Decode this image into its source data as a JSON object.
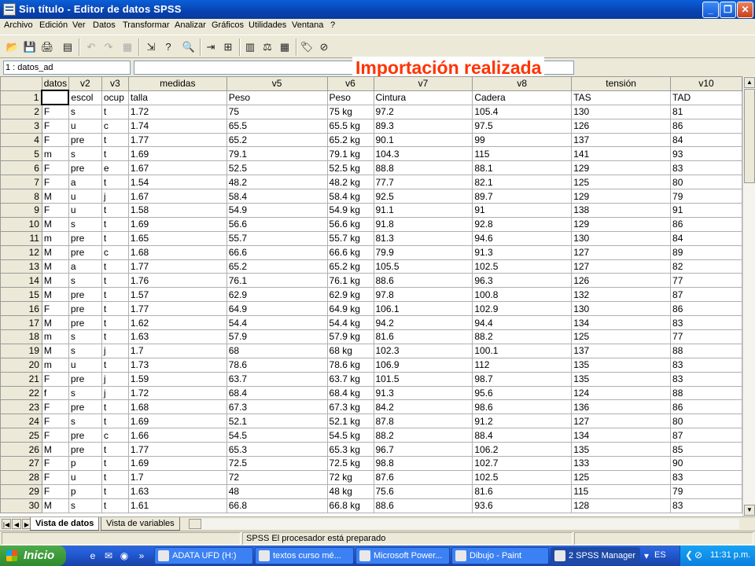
{
  "window": {
    "title": "Sin título - Editor de datos SPSS",
    "minimize_label": "_",
    "maximize_label": "❐",
    "close_label": "✕"
  },
  "menu": [
    "Archivo",
    "Edición",
    "Ver",
    "Datos",
    "Transformar",
    "Analizar",
    "Gráficos",
    "Utilidades",
    "Ventana",
    "?"
  ],
  "toolbar": {
    "icons": [
      "open-icon",
      "save-icon",
      "print-icon",
      "dialog-recall-icon",
      "undo-icon",
      "redo-icon",
      "chart-builder-icon",
      "goto-case-icon",
      "variables-info-icon",
      "find-icon",
      "insert-case-icon",
      "insert-variable-icon",
      "split-file-icon",
      "weight-cases-icon",
      "select-cases-icon",
      "value-labels-icon",
      "use-sets-icon"
    ]
  },
  "cell_editor": {
    "reference": "1 : datos_ad",
    "value": ""
  },
  "overlay_caption": "Importación realizada",
  "columns": [
    "datos",
    "v2",
    "v3",
    "medidas",
    "v5",
    "v6",
    "v7",
    "v8",
    "tensión",
    "v10"
  ],
  "rows": [
    [
      "",
      "escol",
      "ocup",
      "talla",
      "Peso",
      "Peso",
      "Cintura",
      "Cadera",
      "TAS",
      "TAD"
    ],
    [
      "F",
      "s",
      "t",
      "1.72",
      "75",
      "75 kg",
      "97.2",
      "105.4",
      "130",
      "81"
    ],
    [
      "F",
      "u",
      "c",
      "1.74",
      "65.5",
      "65.5 kg",
      "89.3",
      "97.5",
      "126",
      "86"
    ],
    [
      "F",
      "pre",
      "t",
      "1.77",
      "65.2",
      "65.2 kg",
      "90.1",
      "99",
      "137",
      "84"
    ],
    [
      "m",
      "s",
      "t",
      "1.69",
      "79.1",
      "79.1 kg",
      "104.3",
      "115",
      "141",
      "93"
    ],
    [
      "F",
      "pre",
      "e",
      "1.67",
      "52.5",
      "52.5 kg",
      "88.8",
      "88.1",
      "129",
      "83"
    ],
    [
      "F",
      "a",
      "t",
      "1.54",
      "48.2",
      "48.2 kg",
      "77.7",
      "82.1",
      "125",
      "80"
    ],
    [
      "M",
      "u",
      "j",
      "1.67",
      "58.4",
      "58.4 kg",
      "92.5",
      "89.7",
      "129",
      "79"
    ],
    [
      "F",
      "u",
      "t",
      "1.58",
      "54.9",
      "54.9 kg",
      "91.1",
      "91",
      "138",
      "91"
    ],
    [
      "M",
      "s",
      "t",
      "1.69",
      "56.6",
      "56.6 kg",
      "91.8",
      "92.8",
      "129",
      "86"
    ],
    [
      "m",
      "pre",
      "t",
      "1.65",
      "55.7",
      "55.7 kg",
      "81.3",
      "94.6",
      "130",
      "84"
    ],
    [
      "M",
      "pre",
      "c",
      "1.68",
      "66.6",
      "66.6 kg",
      "79.9",
      "91.3",
      "127",
      "89"
    ],
    [
      "M",
      "a",
      "t",
      "1.77",
      "65.2",
      "65.2 kg",
      "105.5",
      "102.5",
      "127",
      "82"
    ],
    [
      "M",
      "s",
      "t",
      "1.76",
      "76.1",
      "76.1 kg",
      "88.6",
      "96.3",
      "126",
      "77"
    ],
    [
      "M",
      "pre",
      "t",
      "1.57",
      "62.9",
      "62.9 kg",
      "97.8",
      "100.8",
      "132",
      "87"
    ],
    [
      "F",
      "pre",
      "t",
      "1.77",
      "64.9",
      "64.9 kg",
      "106.1",
      "102.9",
      "130",
      "86"
    ],
    [
      "M",
      "pre",
      "t",
      "1.62",
      "54.4",
      "54.4 kg",
      "94.2",
      "94.4",
      "134",
      "83"
    ],
    [
      "m",
      "s",
      "t",
      "1.63",
      "57.9",
      "57.9 kg",
      "81.6",
      "88.2",
      "125",
      "77"
    ],
    [
      "M",
      "s",
      "j",
      "1.7",
      "68",
      "68 kg",
      "102.3",
      "100.1",
      "137",
      "88"
    ],
    [
      "m",
      "u",
      "t",
      "1.73",
      "78.6",
      "78.6 kg",
      "106.9",
      "112",
      "135",
      "83"
    ],
    [
      "F",
      "pre",
      "j",
      "1.59",
      "63.7",
      "63.7 kg",
      "101.5",
      "98.7",
      "135",
      "83"
    ],
    [
      "f",
      "s",
      "j",
      "1.72",
      "68.4",
      "68.4 kg",
      "91.3",
      "95.6",
      "124",
      "88"
    ],
    [
      "F",
      "pre",
      "t",
      "1.68",
      "67.3",
      "67.3 kg",
      "84.2",
      "98.6",
      "136",
      "86"
    ],
    [
      "F",
      "s",
      "t",
      "1.69",
      "52.1",
      "52.1 kg",
      "87.8",
      "91.2",
      "127",
      "80"
    ],
    [
      "F",
      "pre",
      "c",
      "1.66",
      "54.5",
      "54.5 kg",
      "88.2",
      "88.4",
      "134",
      "87"
    ],
    [
      "M",
      "pre",
      "t",
      "1.77",
      "65.3",
      "65.3 kg",
      "96.7",
      "106.2",
      "135",
      "85"
    ],
    [
      "F",
      "p",
      "t",
      "1.69",
      "72.5",
      "72.5 kg",
      "98.8",
      "102.7",
      "133",
      "90"
    ],
    [
      "F",
      "u",
      "t",
      "1.7",
      "72",
      "72 kg",
      "87.6",
      "102.5",
      "125",
      "83"
    ],
    [
      "F",
      "p",
      "t",
      "1.63",
      "48",
      "48 kg",
      "75.6",
      "81.6",
      "115",
      "79"
    ],
    [
      "M",
      "s",
      "t",
      "1.61",
      "66.8",
      "66.8 kg",
      "88.6",
      "93.6",
      "128",
      "83"
    ]
  ],
  "tabs": [
    "Vista de datos",
    "Vista de variables"
  ],
  "status": {
    "processor": "SPSS El procesador  está preparado"
  },
  "taskbar": {
    "start_label": "Inicio",
    "quick_launch_more": "»",
    "tasks": [
      "ADATA UFD (H:)",
      "textos curso mé...",
      "Microsoft Power...",
      "Dibujo - Paint",
      "2 SPSS Manager"
    ],
    "task_overflow": "▾",
    "language": "ES",
    "clock": "11:31 p.m."
  }
}
